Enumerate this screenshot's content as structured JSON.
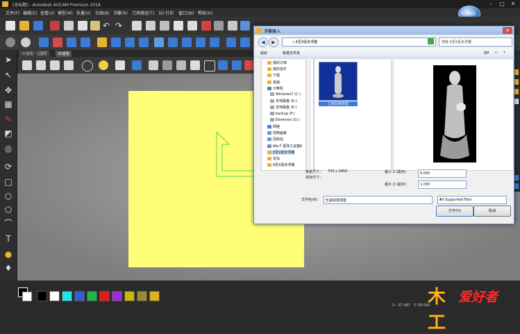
{
  "window": {
    "title": "[无标题] - Autodesk ArtCAM Premium 2018"
  },
  "logo": {
    "text": "SOURCE"
  },
  "menu": [
    "文件(F)",
    "编辑(E)",
    "查看(V)",
    "模型(M)",
    "矢量(V)",
    "位图(B)",
    "浮雕(R)",
    "刀具路径(T)",
    "3D 打印",
    "窗口(W)",
    "帮助(H)"
  ],
  "view_tabs": [
    {
      "label": "2D查看 - 位图层",
      "active": false
    },
    {
      "label": "3D查看",
      "active": true
    }
  ],
  "palette": [
    "#000000",
    "#ffffff",
    "#1ee6e6",
    "#2f5fd6",
    "#22b34a",
    "#e21b1b",
    "#9b30d4",
    "#c9b900",
    "#9a8a2a",
    "#e0b020"
  ],
  "status": {
    "x": "X: -37.487",
    "y": "Y: 59.593"
  },
  "watermark": {
    "brand1": "木工",
    "brand2": "爱好者"
  },
  "dialog": {
    "title": "浮雕输入",
    "address": "« 8至9毫米浮雕",
    "search_placeholder": "搜索 8至9毫米浮雕",
    "organize": "组织",
    "new_folder": "新建文件夹",
    "tree": [
      {
        "label": "我的文档",
        "icon": "folder-icon",
        "selected": false
      },
      {
        "label": "我的音乐",
        "icon": "folder-icon",
        "selected": false
      },
      {
        "label": "下载",
        "icon": "folder-icon",
        "selected": false
      },
      {
        "label": "桌面",
        "icon": "folder-icon",
        "selected": false
      },
      {
        "label": "计算机",
        "icon": "computer-icon",
        "selected": false
      },
      {
        "label": "Windows7 (C:)",
        "icon": "drive-icon",
        "selected": false
      },
      {
        "label": "本地磁盘 (D:)",
        "icon": "drive-icon",
        "selected": false
      },
      {
        "label": "本地磁盘 (E:)",
        "icon": "drive-icon",
        "selected": false
      },
      {
        "label": "backup (F:)",
        "icon": "drive-icon",
        "selected": false
      },
      {
        "label": "Elements (G:)",
        "icon": "drive-icon",
        "selected": false
      },
      {
        "label": "网络",
        "icon": "network-icon",
        "selected": false
      },
      {
        "label": "控制面板",
        "icon": "control-panel-icon",
        "selected": false
      },
      {
        "label": "回收站",
        "icon": "recycle-bin-icon",
        "selected": false
      },
      {
        "label": "Win7 更改工具箱6",
        "icon": "tool-icon",
        "selected": false
      },
      {
        "label": "8至9毫米浮雕",
        "icon": "folder-icon",
        "selected": true
      },
      {
        "label": "论坛",
        "icon": "folder-icon",
        "selected": false
      },
      {
        "label": "8至9毫米浮雕",
        "icon": "folder-icon",
        "selected": false
      }
    ],
    "file": {
      "name": "立姿如意观音"
    },
    "info": {
      "pixel_size_label": "像素尺寸：",
      "pixel_size_value": "733 x 1850",
      "real_size_label": "实际尺寸：",
      "min_z_label": "最小 Z (毫米)：",
      "min_z_value": "0.000",
      "max_z_label": "最大 Z (毫米)：",
      "max_z_value": "1.000"
    },
    "filename_label": "文件名(N):",
    "filename_value": "立姿如意观音",
    "filetype_value": "All Supported Files",
    "open_label": "打开(O)",
    "cancel_label": "取消"
  }
}
